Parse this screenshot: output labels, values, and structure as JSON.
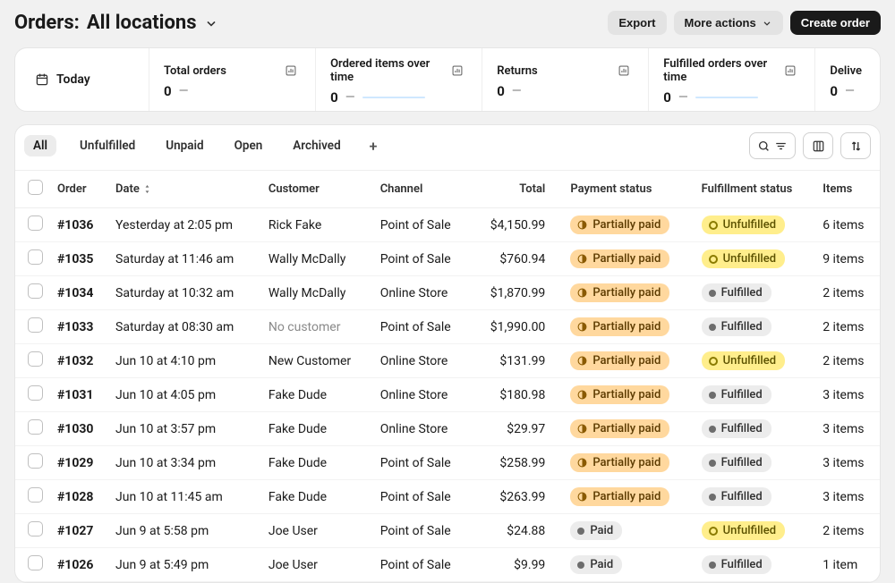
{
  "header": {
    "title_prefix": "Orders:",
    "title_value": "All locations",
    "export_label": "Export",
    "more_actions_label": "More actions",
    "create_label": "Create order"
  },
  "summary": {
    "today_label": "Today",
    "stats": [
      {
        "label": "Total orders",
        "value": "0",
        "spark": false
      },
      {
        "label": "Ordered items over time",
        "value": "0",
        "spark": true
      },
      {
        "label": "Returns",
        "value": "0",
        "spark": false
      },
      {
        "label": "Fulfilled orders over time",
        "value": "0",
        "spark": true
      },
      {
        "label": "Delive",
        "value": "0",
        "spark": false
      }
    ]
  },
  "filters": {
    "items": [
      "All",
      "Unfulfilled",
      "Unpaid",
      "Open",
      "Archived"
    ],
    "active_index": 0
  },
  "columns": {
    "order": "Order",
    "date": "Date",
    "customer": "Customer",
    "channel": "Channel",
    "total": "Total",
    "payment": "Payment status",
    "fulfillment": "Fulfillment status",
    "items": "Items"
  },
  "pills": {
    "partially_paid": "Partially paid",
    "paid": "Paid",
    "unfulfilled": "Unfulfilled",
    "fulfilled": "Fulfilled"
  },
  "rows": [
    {
      "order": "#1036",
      "date": "Yesterday at 2:05 pm",
      "customer": "Rick Fake",
      "customer_muted": false,
      "channel": "Point of Sale",
      "total": "$4,150.99",
      "payment": "partially_paid",
      "fulfillment": "unfulfilled",
      "items": "6 items"
    },
    {
      "order": "#1035",
      "date": "Saturday at 11:46 am",
      "customer": "Wally McDally",
      "customer_muted": false,
      "channel": "Point of Sale",
      "total": "$760.94",
      "payment": "partially_paid",
      "fulfillment": "unfulfilled",
      "items": "9 items"
    },
    {
      "order": "#1034",
      "date": "Saturday at 10:32 am",
      "customer": "Wally McDally",
      "customer_muted": false,
      "channel": "Online Store",
      "total": "$1,870.99",
      "payment": "partially_paid",
      "fulfillment": "fulfilled",
      "items": "2 items"
    },
    {
      "order": "#1033",
      "date": "Saturday at 08:30 am",
      "customer": "No customer",
      "customer_muted": true,
      "channel": "Point of Sale",
      "total": "$1,990.00",
      "payment": "partially_paid",
      "fulfillment": "fulfilled",
      "items": "2 items"
    },
    {
      "order": "#1032",
      "date": "Jun 10 at 4:10 pm",
      "customer": "New Customer",
      "customer_muted": false,
      "channel": "Online Store",
      "total": "$131.99",
      "payment": "partially_paid",
      "fulfillment": "unfulfilled",
      "items": "2 items"
    },
    {
      "order": "#1031",
      "date": "Jun 10 at 4:05 pm",
      "customer": "Fake Dude",
      "customer_muted": false,
      "channel": "Online Store",
      "total": "$180.98",
      "payment": "partially_paid",
      "fulfillment": "fulfilled",
      "items": "3 items"
    },
    {
      "order": "#1030",
      "date": "Jun 10 at 3:57 pm",
      "customer": "Fake Dude",
      "customer_muted": false,
      "channel": "Online Store",
      "total": "$29.97",
      "payment": "partially_paid",
      "fulfillment": "fulfilled",
      "items": "3 items"
    },
    {
      "order": "#1029",
      "date": "Jun 10 at 3:34 pm",
      "customer": "Fake Dude",
      "customer_muted": false,
      "channel": "Point of Sale",
      "total": "$258.99",
      "payment": "partially_paid",
      "fulfillment": "fulfilled",
      "items": "3 items"
    },
    {
      "order": "#1028",
      "date": "Jun 10 at 11:45 am",
      "customer": "Fake Dude",
      "customer_muted": false,
      "channel": "Point of Sale",
      "total": "$263.99",
      "payment": "partially_paid",
      "fulfillment": "fulfilled",
      "items": "3 items"
    },
    {
      "order": "#1027",
      "date": "Jun 9 at 5:58 pm",
      "customer": "Joe User",
      "customer_muted": false,
      "channel": "Point of Sale",
      "total": "$24.88",
      "payment": "paid",
      "fulfillment": "unfulfilled",
      "items": "2 items"
    },
    {
      "order": "#1026",
      "date": "Jun 9 at 5:49 pm",
      "customer": "Joe User",
      "customer_muted": false,
      "channel": "Point of Sale",
      "total": "$9.99",
      "payment": "paid",
      "fulfillment": "fulfilled",
      "items": "1 item"
    }
  ]
}
